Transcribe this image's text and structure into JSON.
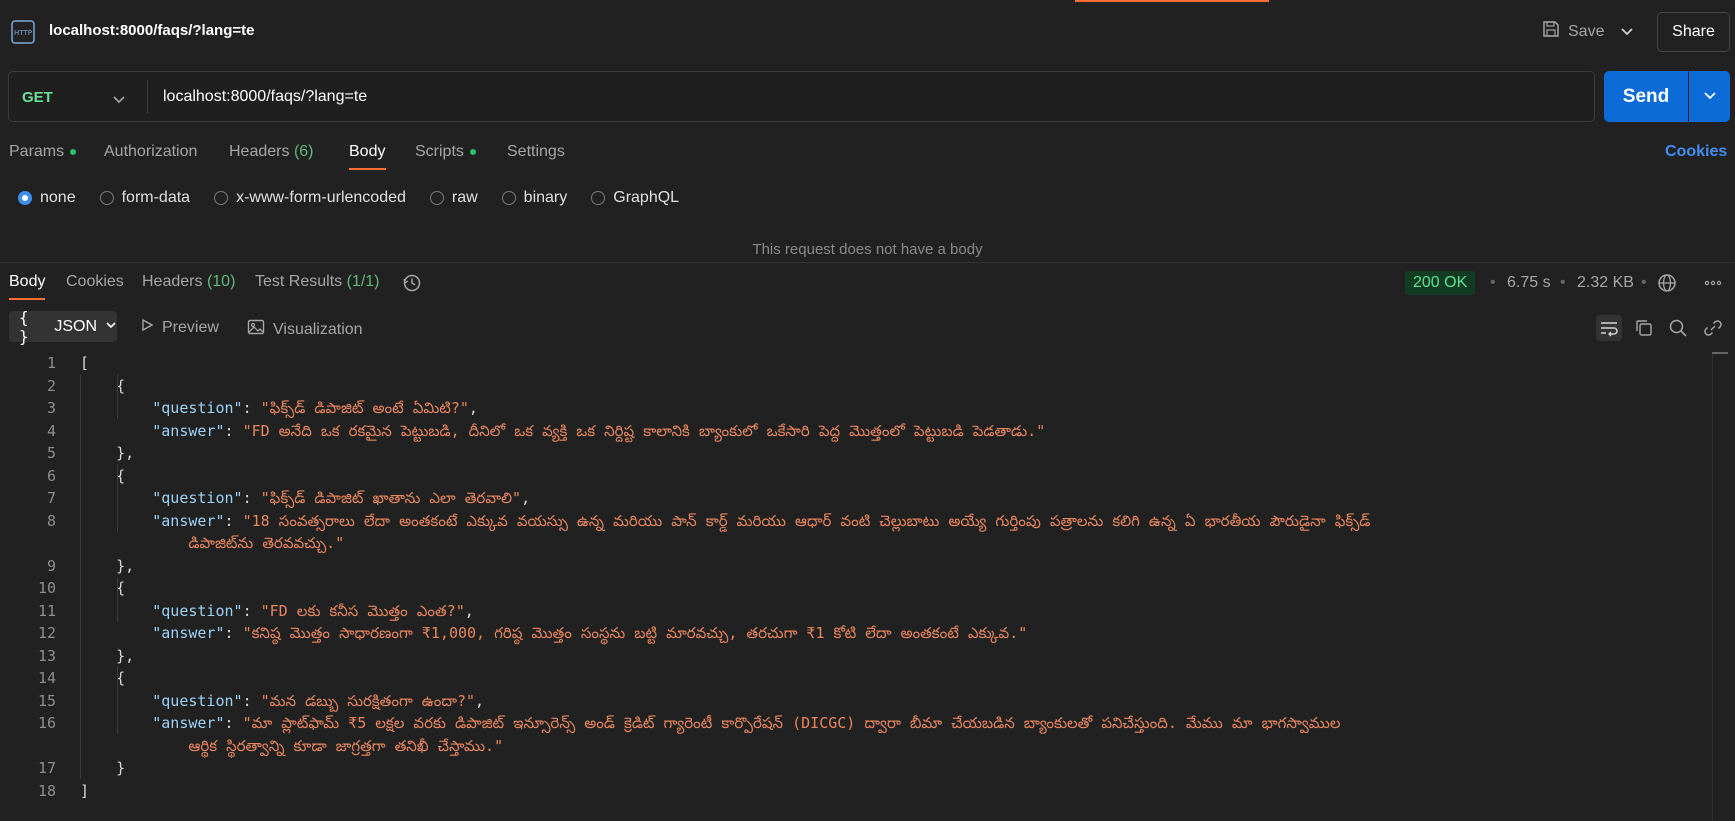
{
  "header": {
    "tab_title": "localhost:8000/faqs/?lang=te",
    "save_label": "Save",
    "share_label": "Share",
    "http_icon": "http-file-icon"
  },
  "request": {
    "method": "GET",
    "url": "localhost:8000/faqs/?lang=te",
    "send_label": "Send"
  },
  "request_tabs": {
    "params": "Params",
    "authorization": "Authorization",
    "headers": "Headers",
    "headers_count": "(6)",
    "body": "Body",
    "scripts": "Scripts",
    "settings": "Settings",
    "cookies": "Cookies"
  },
  "body_types": {
    "none": "none",
    "form_data": "form-data",
    "urlencoded": "x-www-form-urlencoded",
    "raw": "raw",
    "binary": "binary",
    "graphql": "GraphQL",
    "selected": "none"
  },
  "no_body_text": "This request does not have a body",
  "response_tabs": {
    "body": "Body",
    "cookies": "Cookies",
    "headers": "Headers",
    "headers_count": "(10)",
    "tests": "Test Results",
    "tests_count": "(1/1)"
  },
  "response_meta": {
    "status": "200 OK",
    "time": "6.75 s",
    "size": "2.32 KB",
    "status_color": "#5ce08f"
  },
  "response_toolbar": {
    "format": "JSON",
    "preview": "Preview",
    "visualization": "Visualization"
  },
  "code": {
    "line_numbers": [
      "1",
      "2",
      "3",
      "4",
      "5",
      "6",
      "7",
      "8",
      "",
      "9",
      "10",
      "11",
      "12",
      "13",
      "14",
      "15",
      "16",
      "",
      "17",
      "18"
    ],
    "faqs": [
      {
        "question": "ఫిక్స్‌డ్ డిపాజిట్ అంటే ఏమిటి?",
        "answer": "FD అనేది ఒక రకమైన పెట్టుబడి, దీనిలో ఒక వ్యక్తి ఒక నిర్దిష్ట కాలానికి బ్యాంకులో ఒకేసారి పెద్ద మొత్తంలో పెట్టుబడి పెడతాడు."
      },
      {
        "question": "ఫిక్స్‌డ్ డిపాజిట్ ఖాతాను ఎలా తెరవాలి",
        "answer_l1": "18 సంవత్సరాలు లేదా అంతకంటే ఎక్కువ వయస్సు ఉన్న మరియు పాన్ కార్డ్ మరియు ఆధార్ వంటి చెల్లుబాటు అయ్యే గుర్తింపు పత్రాలను కలిగి ఉన్న ఏ భారతీయ పౌరుడైనా ఫిక్స్‌డ్",
        "answer_l2": "డిపాజిట్‌ను తెరవవచ్చు."
      },
      {
        "question": "FD లకు కనీస మొత్తం ఎంత?",
        "answer": "కనిష్ఠ మొత్తం సాధారణంగా ₹1,000, గరిష్ఠ మొత్తం సంస్థను బట్టి మారవచ్చు, తరచుగా ₹1 కోటి లేదా అంతకంటే ఎక్కువ."
      },
      {
        "question": "మన డబ్బు సురక్షితంగా ఉందా?",
        "answer_l1": "మా ప్లాట్‌ఫామ్ ₹5 లక్షల వరకు డిపాజిట్ ఇన్సూరెన్స్ అండ్ క్రెడిట్ గ్యారెంటీ కార్పొరేషన్ (DICGC) ద్వారా బీమా చేయబడిన బ్యాంకులతో పనిచేస్తుంది. మేము మా భాగస్వాముల",
        "answer_l2": "ఆర్థిక స్థిరత్వాన్ని కూడా జాగ్రత్తగా తనిఖీ చేస్తాము."
      }
    ]
  }
}
